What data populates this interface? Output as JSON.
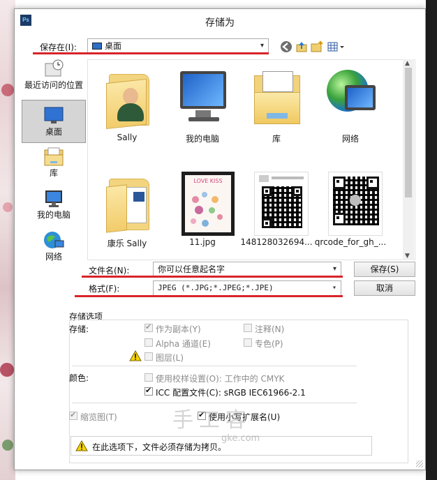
{
  "title": "存储为",
  "save_in": {
    "label": "保存在(I):",
    "value": "桌面"
  },
  "places": [
    {
      "label": "最近访问的位置"
    },
    {
      "label": "桌面"
    },
    {
      "label": "库"
    },
    {
      "label": "我的电脑"
    },
    {
      "label": "网络"
    }
  ],
  "files": [
    {
      "name": "Sally",
      "icon": "user-folder-icon"
    },
    {
      "name": "我的电脑",
      "icon": "computer-icon"
    },
    {
      "name": "库",
      "icon": "library-folder-icon"
    },
    {
      "name": "网络",
      "icon": "network-globe-icon"
    },
    {
      "name": "康乐 Sally",
      "icon": "folder-icon"
    },
    {
      "name": "11.jpg",
      "icon": "image-thumbnail",
      "thumb_text": "LOVE KISS"
    },
    {
      "name": "148128032694...",
      "icon": "qr-thumbnail"
    },
    {
      "name": "qrcode_for_gh_...",
      "icon": "qr-thumbnail"
    }
  ],
  "filename": {
    "label": "文件名(N):",
    "value": "你可以任意起名字"
  },
  "format": {
    "label": "格式(F):",
    "value": "JPEG (*.JPG;*.JPEG;*.JPE)"
  },
  "buttons": {
    "save": "保存(S)",
    "cancel": "取消"
  },
  "options": {
    "group_title": "存储选项",
    "save_label": "存储:",
    "as_copy": {
      "label": "作为副本(Y)",
      "checked": true,
      "disabled": true
    },
    "notes": {
      "label": "注释(N)",
      "checked": false,
      "disabled": true
    },
    "alpha": {
      "label": "Alpha 通道(E)",
      "checked": false,
      "disabled": true
    },
    "spot": {
      "label": "专色(P)",
      "checked": false,
      "disabled": true
    },
    "layers": {
      "label": "图层(L)",
      "checked": false,
      "disabled": true
    },
    "color_label": "颜色:",
    "proof": {
      "label": "使用校样设置(O):  工作中的 CMYK",
      "checked": false,
      "disabled": true
    },
    "icc": {
      "label": "ICC 配置文件(C):  sRGB IEC61966-2.1",
      "checked": true,
      "disabled": false
    },
    "thumbnail": {
      "label": "缩览图(T)",
      "checked": true,
      "disabled": true
    },
    "lowercase_ext": {
      "label": "使用小写扩展名(U)",
      "checked": true,
      "disabled": false
    },
    "warning_text": "在此选项下，文件必须存储为拷贝。"
  },
  "watermark": {
    "main": "手工客",
    "sub": "gke.com"
  },
  "colors": {
    "annotation_red": "#d8232a",
    "dialog_bg": "#ffffff"
  }
}
